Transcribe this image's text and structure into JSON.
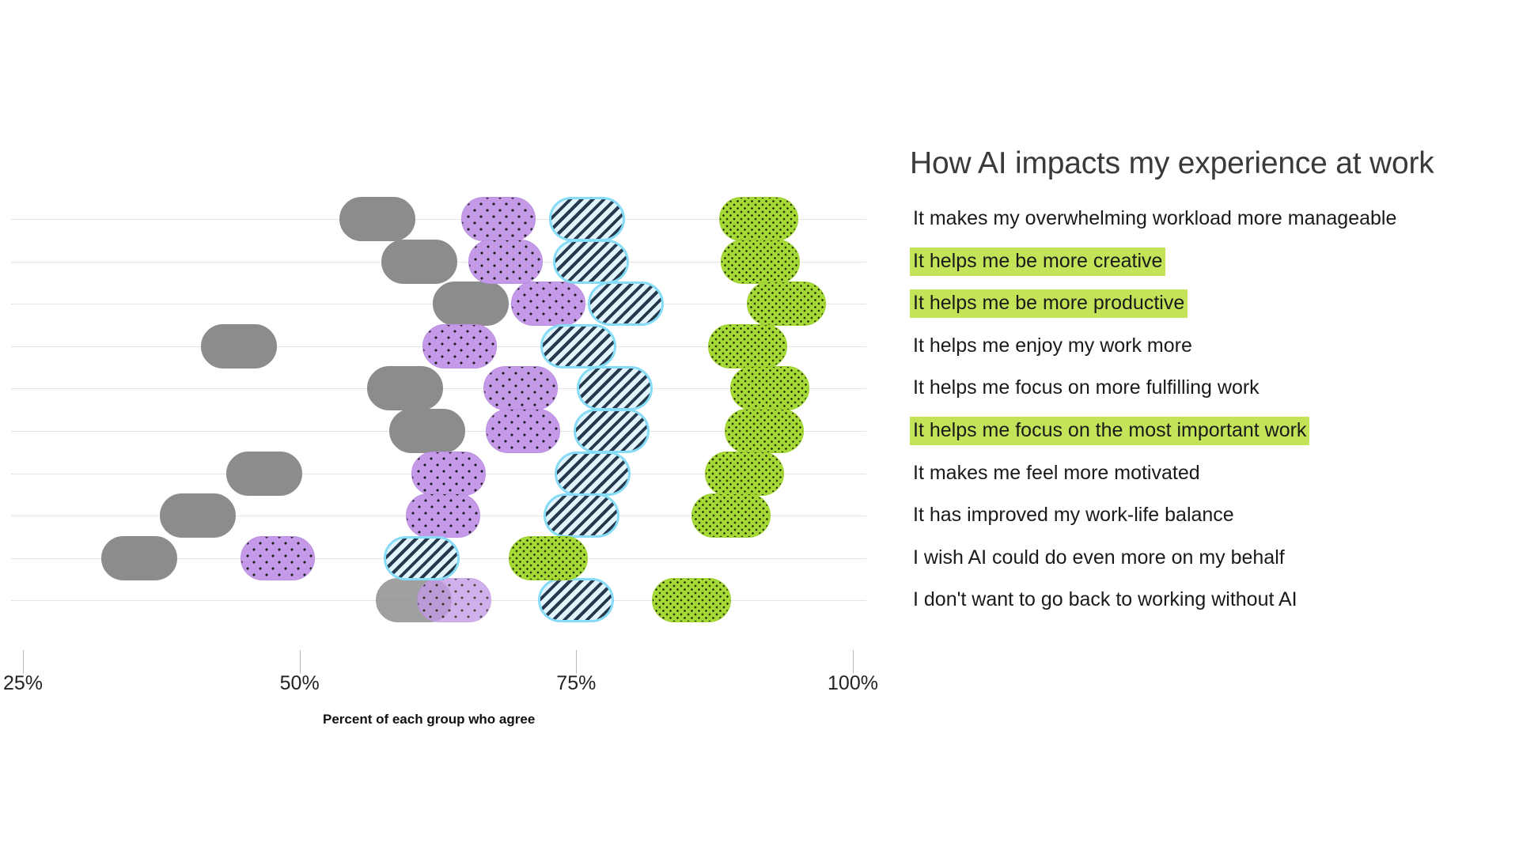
{
  "panel": {
    "title": "How AI impacts my experience at work"
  },
  "chart_data": {
    "type": "scatter",
    "title": "How AI impacts my experience at work",
    "xlabel": "Percent of each group who agree",
    "ylabel": "",
    "xlim": [
      25,
      100
    ],
    "xticks": [
      25,
      50,
      75,
      100
    ],
    "xtick_labels": [
      "25%",
      "50%",
      "75%",
      "100%"
    ],
    "grid": true,
    "legend_position": "none",
    "series": [
      {
        "name": "group-gray",
        "marker": "gray-solid",
        "color": "#8c8c8c",
        "values": [
          57.0,
          60.8,
          65.5,
          44.5,
          59.5,
          61.5,
          46.8,
          40.8,
          35.5,
          60.3
        ]
      },
      {
        "name": "group-purple",
        "marker": "purple-dots",
        "color": "#c49ae8",
        "values": [
          68.0,
          68.6,
          72.5,
          64.5,
          70.0,
          70.2,
          63.5,
          63.0,
          48.0,
          64.0
        ]
      },
      {
        "name": "group-striped",
        "marker": "cyan-stripes",
        "color": "#86dcf6",
        "values": [
          76.0,
          76.3,
          79.5,
          75.2,
          78.5,
          78.2,
          76.5,
          75.5,
          61.0,
          75.0
        ]
      },
      {
        "name": "group-green",
        "marker": "green-dots",
        "color": "#a5d935",
        "values": [
          91.5,
          91.6,
          94.0,
          90.5,
          92.5,
          92.0,
          90.2,
          89.0,
          72.5,
          85.4
        ]
      }
    ],
    "categories": [
      "It makes my overwhelming workload more manageable",
      "It helps me be more creative",
      "It helps me be more productive",
      "It helps me enjoy my work more",
      "It helps me focus on more fulfilling work",
      "It helps me focus on the most important work",
      "It makes me feel more motivated",
      "It has improved my work-life balance",
      "I wish AI could do even more on my behalf",
      "I don't want to go back to working without AI"
    ]
  },
  "axis": {
    "title": "Percent of each group who agree",
    "ticks": [
      {
        "label": "25%",
        "value": 25
      },
      {
        "label": "50%",
        "value": 50
      },
      {
        "label": "75%",
        "value": 75
      },
      {
        "label": "100%",
        "value": 100
      }
    ]
  },
  "statements": [
    {
      "text": "It makes my overwhelming workload more manageable",
      "highlighted": false
    },
    {
      "text": "It helps me be more creative",
      "highlighted": true
    },
    {
      "text": "It helps me be more productive",
      "highlighted": true
    },
    {
      "text": "It helps me enjoy my work more",
      "highlighted": false
    },
    {
      "text": "It helps me focus on more fulfilling work",
      "highlighted": false
    },
    {
      "text": "It helps me focus on the most important work",
      "highlighted": true
    },
    {
      "text": "It makes me feel more motivated",
      "highlighted": false
    },
    {
      "text": "It has improved my work-life balance",
      "highlighted": false
    },
    {
      "text": "I wish AI could do even more on my behalf",
      "highlighted": false
    },
    {
      "text": "I don't want to go back to working without AI",
      "highlighted": false
    }
  ],
  "colors": {
    "highlight": "#c3e359",
    "gray_series": "#8c8c8c",
    "purple_series": "#c49ae8",
    "striped_series": "#86dcf6",
    "green_series": "#a5d935",
    "gridline": "#e3e3e3"
  }
}
